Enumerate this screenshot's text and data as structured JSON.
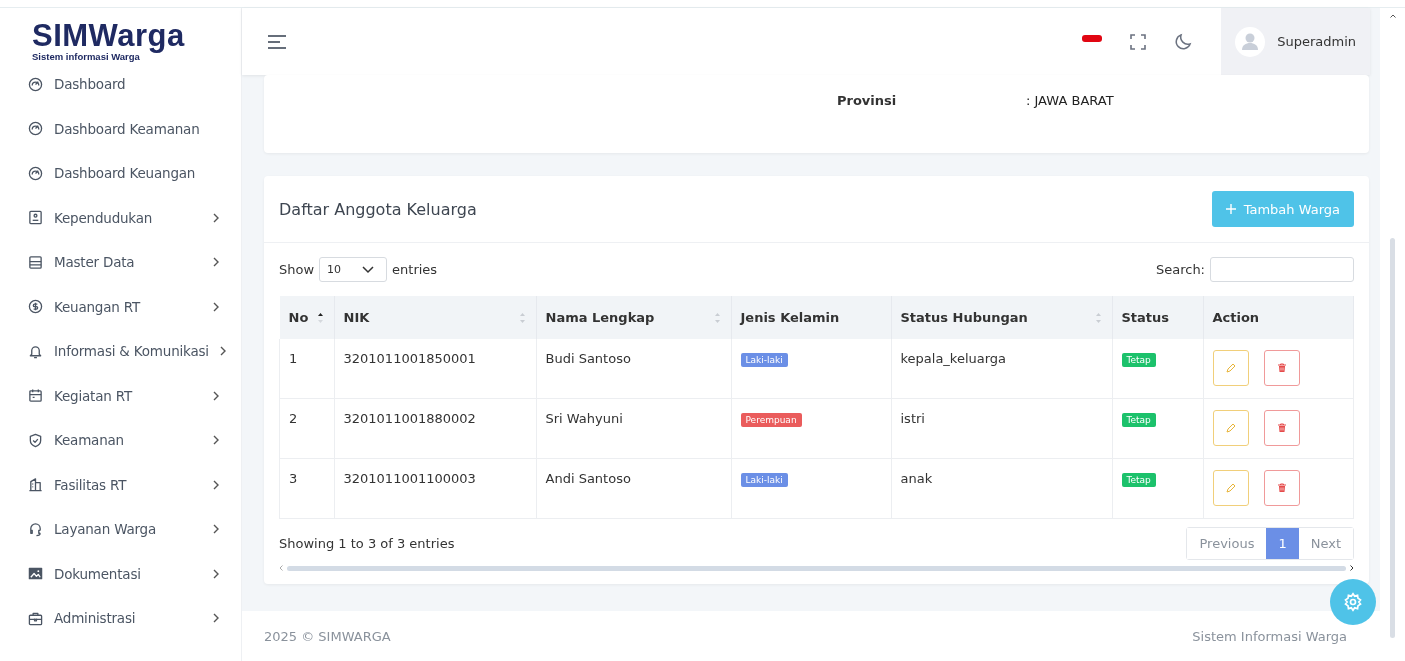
{
  "logo": {
    "name": "SIMWarga",
    "tagline": "Sistem informasi Warga"
  },
  "sidebar": {
    "items": [
      {
        "label": "Dashboard",
        "expandable": false
      },
      {
        "label": "Dashboard Keamanan",
        "expandable": false
      },
      {
        "label": "Dashboard Keuangan",
        "expandable": false
      },
      {
        "label": "Kependudukan",
        "expandable": true
      },
      {
        "label": "Master Data",
        "expandable": true
      },
      {
        "label": "Keuangan RT",
        "expandable": true
      },
      {
        "label": "Informasi & Komunikasi",
        "expandable": true
      },
      {
        "label": "Kegiatan RT",
        "expandable": true
      },
      {
        "label": "Keamanan",
        "expandable": true
      },
      {
        "label": "Fasilitas RT",
        "expandable": true
      },
      {
        "label": "Layanan Warga",
        "expandable": true
      },
      {
        "label": "Dokumentasi",
        "expandable": true
      },
      {
        "label": "Administrasi",
        "expandable": true
      }
    ]
  },
  "header": {
    "user": "Superadmin"
  },
  "info_card": {
    "fields": [
      {
        "label": "Provinsi",
        "value": ": JAWA BARAT"
      }
    ]
  },
  "family_card": {
    "title": "Daftar Anggota Keluarga",
    "add_button": "Tambah Warga",
    "length_label_before": "Show",
    "length_value": "10",
    "length_label_after": "entries",
    "search_label": "Search:",
    "table": {
      "columns": [
        {
          "label": "No",
          "sortable": true,
          "sorted": true
        },
        {
          "label": "NIK",
          "sortable": true,
          "sorted": false
        },
        {
          "label": "Nama Lengkap",
          "sortable": true,
          "sorted": false
        },
        {
          "label": "Jenis Kelamin",
          "sortable": false,
          "sorted": false
        },
        {
          "label": "Status Hubungan",
          "sortable": true,
          "sorted": false
        },
        {
          "label": "Status",
          "sortable": false,
          "sorted": false
        },
        {
          "label": "Action",
          "sortable": false,
          "sorted": false
        }
      ],
      "rows": [
        {
          "no": "1",
          "nik": "3201011001850001",
          "name": "Budi Santoso",
          "gender": {
            "text": "Laki-laki",
            "color": "#6b8fe6"
          },
          "relation": "kepala_keluarga",
          "status": {
            "text": "Tetap",
            "color": "#1cc16b"
          }
        },
        {
          "no": "2",
          "nik": "3201011001880002",
          "name": "Sri Wahyuni",
          "gender": {
            "text": "Perempuan",
            "color": "#ea5c5c"
          },
          "relation": "istri",
          "status": {
            "text": "Tetap",
            "color": "#1cc16b"
          }
        },
        {
          "no": "3",
          "nik": "3201011001100003",
          "name": "Andi Santoso",
          "gender": {
            "text": "Laki-laki",
            "color": "#6b8fe6"
          },
          "relation": "anak",
          "status": {
            "text": "Tetap",
            "color": "#1cc16b"
          }
        }
      ]
    },
    "info": "Showing 1 to 3 of 3 entries",
    "pagination": [
      {
        "label": "Previous",
        "disabled": true,
        "selected": false
      },
      {
        "label": "1",
        "disabled": false,
        "selected": true
      },
      {
        "label": "Next",
        "disabled": true,
        "selected": false
      }
    ]
  },
  "footer": {
    "left": "2025 © SIMWARGA",
    "right": "Sistem Informasi Warga"
  }
}
